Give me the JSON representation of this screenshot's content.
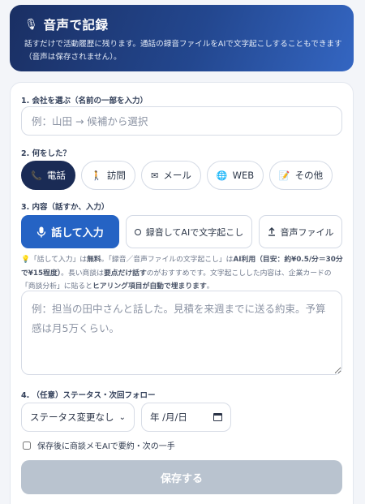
{
  "header": {
    "icon": "microphone-icon",
    "title": "音声で記録",
    "description": "話すだけで活動履歴に残ります。通話の録音ファイルをAIで文字起こしすることもできます（音声は保存されません）。"
  },
  "company": {
    "label": "1. 会社を選ぶ（名前の一部を入力）",
    "placeholder": "例：山田 → 候補から選択",
    "value": ""
  },
  "activity": {
    "label": "2. 何をした？",
    "options": [
      {
        "label": "電話",
        "icon": "phone-icon",
        "selected": true
      },
      {
        "label": "訪問",
        "icon": "walking-person-icon",
        "selected": false
      },
      {
        "label": "メール",
        "icon": "envelope-icon",
        "selected": false
      },
      {
        "label": "WEB",
        "icon": "globe-icon",
        "selected": false
      },
      {
        "label": "その他",
        "icon": "memo-icon",
        "selected": false
      }
    ]
  },
  "content": {
    "label": "3. 内容（話すか、入力）",
    "modes": [
      {
        "label": "話して入力",
        "icon": "microphone-icon",
        "selected": true
      },
      {
        "label": "録音してAIで文字起こし",
        "icon": "record-icon",
        "selected": false
      },
      {
        "label": "音声ファイル",
        "icon": "upload-icon",
        "selected": false
      }
    ],
    "note": {
      "icon": "lightbulb-icon",
      "t1": "「話して入力」は",
      "b1": "無料",
      "t2": "。「録音／音声ファイルの文字起こし」は",
      "b2": "AI利用（目安：約¥0.5/分＝30分で¥15程度）",
      "t3": "。長い商談は",
      "b3": "要点だけ話す",
      "t4": "のがおすすめです。文字起こしした内容は、企業カードの「商談分析」に貼ると",
      "b4": "ヒアリング項目が自動で埋まります",
      "t5": "。"
    },
    "memo_placeholder": "例：担当の田中さんと話した。見積を来週までに送る約束。予算感は月5万くらい。",
    "memo_value": ""
  },
  "followup": {
    "label": "4. （任意）ステータス・次回フォロー",
    "status_selected": "ステータス変更なし",
    "date_placeholder": "年 /月/日",
    "checkbox_label": "保存後に商談メモAIで要約・次の一手",
    "checkbox_checked": false
  },
  "save_label": "保存する",
  "colors": {
    "primary": "#2563c4",
    "selected_pill": "#1a2b55",
    "disabled_button": "#b9c3cf"
  }
}
